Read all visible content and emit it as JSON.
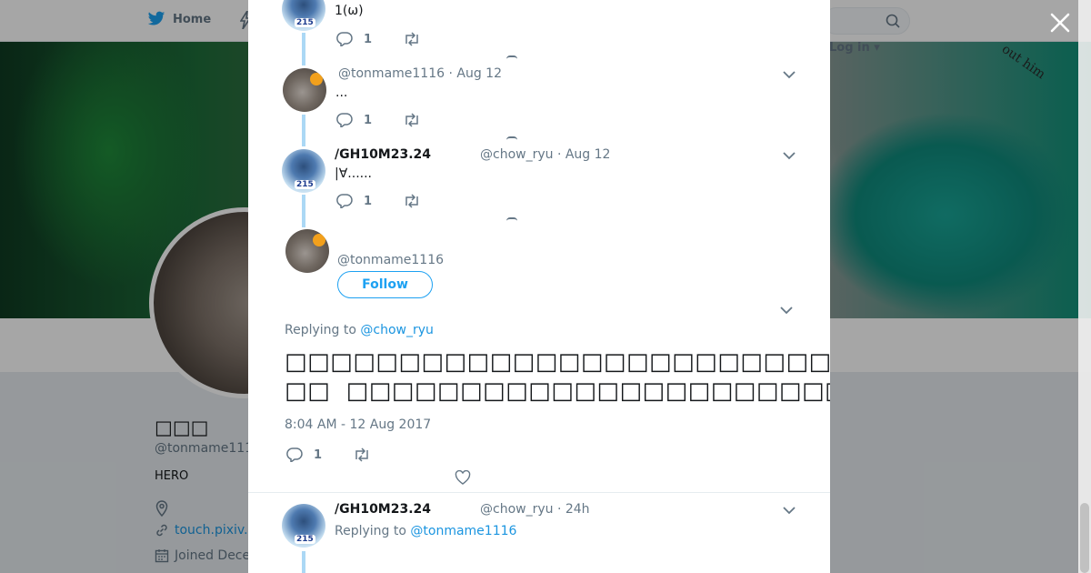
{
  "topbar": {
    "home_label": "Home",
    "login_label": "Log in"
  },
  "banner": {
    "text": "out him"
  },
  "profile": {
    "name": "□□□",
    "handle": "@tonmame111",
    "bio": "HERO",
    "url": "touch.pixiv.",
    "joined": "Joined Dece"
  },
  "thread": [
    {
      "text": "1(ω)",
      "reply_count": "1"
    },
    {
      "handle_time": "@tonmame1116 · Aug 12",
      "text": "...",
      "reply_count": "1"
    },
    {
      "name": "/GH10M23.24",
      "handle_time": "@chow_ryu · Aug 12",
      "text": "|∀......",
      "reply_count": "1"
    }
  ],
  "main_tweet": {
    "handle": "@tonmame1116",
    "follow_label": "Follow",
    "replying_prefix": "Replying to ",
    "replying_to": "@chow_ryu",
    "text": "□□□□□□□□□□□□□□□□□□□□□□□□□□□□□□□□□□□...□\n□□  □□□□□□□□□□□□□□□□□□□□□□□□□□□□□□□□□□□□□□□□□□□□□",
    "timestamp": "8:04 AM - 12 Aug 2017",
    "reply_count": "1"
  },
  "next_reply": {
    "name": "/GH10M23.24",
    "handle_time": "@chow_ryu · 24h",
    "replying_prefix": "Replying to ",
    "replying_to": "@tonmame1116"
  },
  "colors": {
    "accent": "#1da1f2",
    "link": "#1b95e0",
    "muted": "#657786",
    "thread_line": "#abd8f5"
  }
}
